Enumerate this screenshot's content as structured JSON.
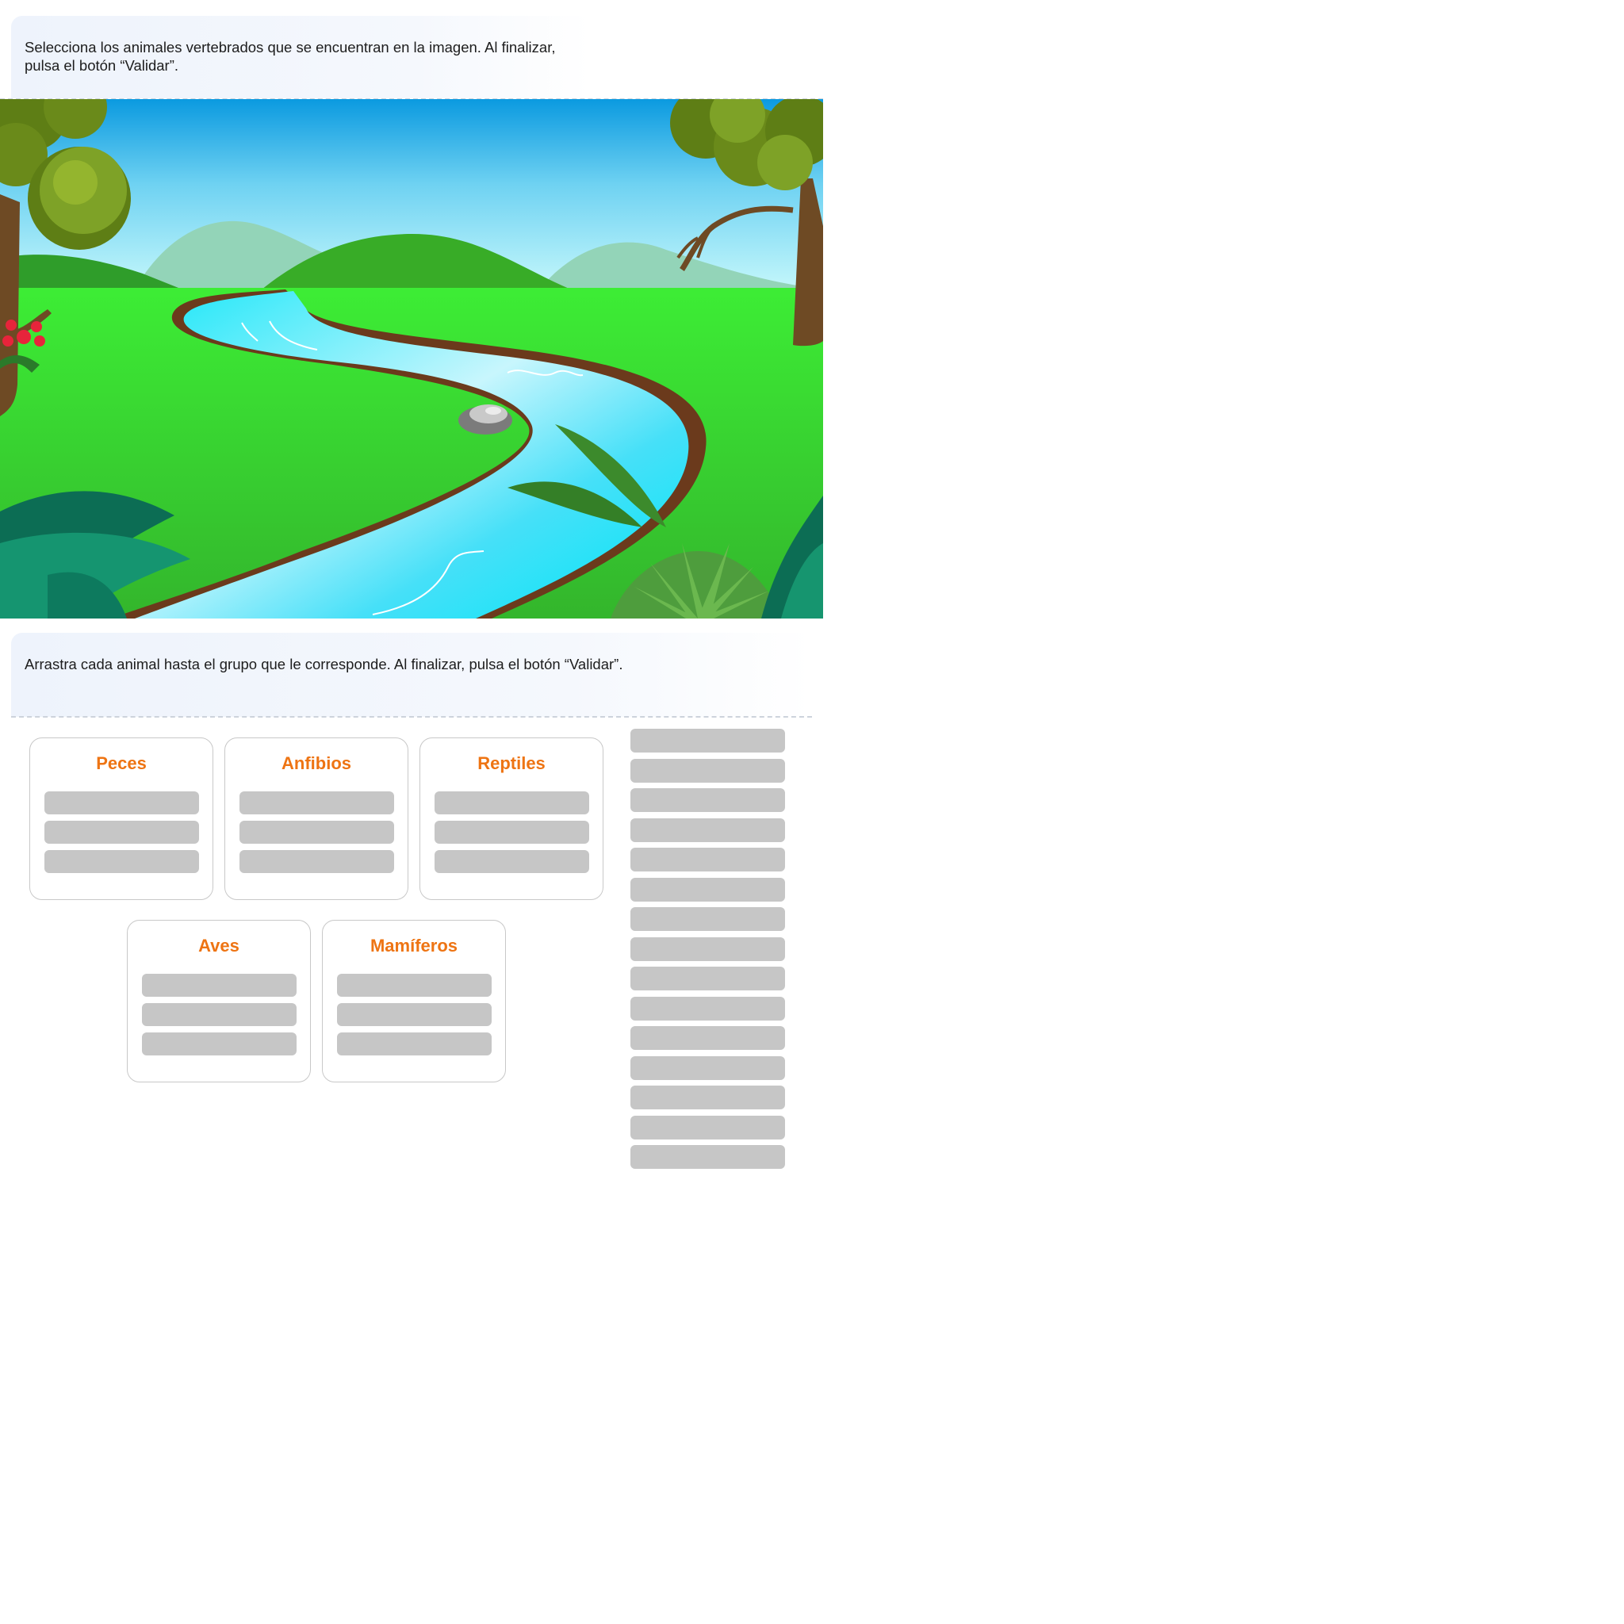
{
  "activity1": {
    "instruction": "Selecciona los animales vertebrados que se encuentran en la imagen. Al finalizar, pulsa el botón “Validar”."
  },
  "activity2": {
    "instruction": "Arrastra cada animal hasta el grupo que le corresponde. Al finalizar, pulsa el botón “Validar”.",
    "groups": [
      {
        "label": "Peces"
      },
      {
        "label": "Anfibios"
      },
      {
        "label": "Reptiles"
      },
      {
        "label": "Aves"
      },
      {
        "label": "Mamíferos"
      }
    ],
    "slots_per_group": 3,
    "draggable_items_count": 15
  },
  "colors": {
    "group_title": "#ee7413",
    "placeholder": "#c6c6c6",
    "instruction_bg": "#eef3fc"
  }
}
